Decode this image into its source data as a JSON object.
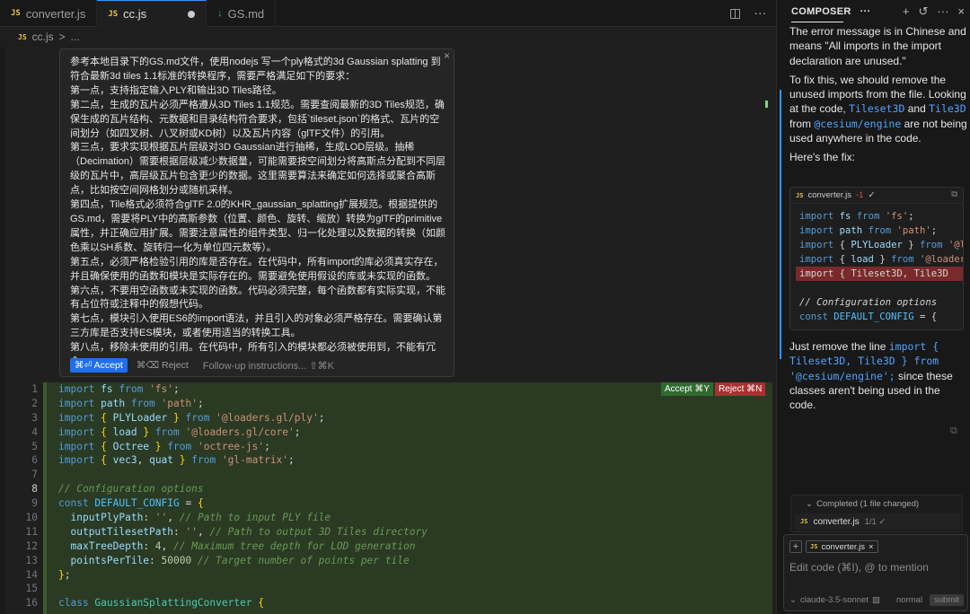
{
  "tabs": [
    {
      "icon": "JS",
      "label": "converter.js",
      "active": false
    },
    {
      "icon": "JS",
      "label": "cc.js",
      "active": true,
      "modified": true
    },
    {
      "icon": "↓",
      "label": "GS.md",
      "active": false
    }
  ],
  "breadcrumb": {
    "icon": "JS",
    "file": "cc.js",
    "sep": ">",
    "more": "..."
  },
  "prompt": {
    "lines": [
      "参考本地目录下的GS.md文件，使用nodejs 写一个ply格式的3d Gaussian splatting 到符合最新3d tiles 1.1标准的转换程序，需要严格满足如下的要求：",
      "第一点，支持指定输入PLY和输出3D Tiles路径。",
      "第二点，生成的瓦片必须严格遵从3D Tiles 1.1规范。需要查阅最新的3D Tiles规范，确保生成的瓦片结构、元数据和目录结构符合要求，包括`tileset.json`的格式、瓦片的空间划分（如四叉树、八叉树或KD树）以及瓦片内容（glTF文件）的引用。",
      "第三点，要求实现根据瓦片层级对3D Gaussian进行抽稀，生成LOD层级。抽稀（Decimation）需要根据层级减少数据量，可能需要按空间划分将高斯点分配到不同层级的瓦片中，高层级瓦片包含更少的数据。这里需要算法来确定如何选择或聚合高斯点，比如按空间网格划分或随机采样。",
      "第四点，Tile格式必须符合glTF 2.0的KHR_gaussian_splatting扩展规范。根据提供的GS.md，需要将PLY中的高斯参数（位置、颜色、旋转、缩放）转换为glTF的primitive属性，并正确应用扩展。需要注意属性的组件类型、归一化处理以及数据的转换（如颜色乘以SH系数、旋转归一化为单位四元数等）。",
      "第五点，必须严格检验引用的库是否存在。在代码中，所有import的库必须真实存在，并且确保使用的函数和模块是实际存在的。需要避免使用假设的库或未实现的函数。",
      "第六点，不要用空函数或未实现的函数。代码必须完整，每个函数都有实际实现，不能有占位符或注释中的假想代码。",
      "第七点，模块引入使用ES6的import语法，并且引入的对象必须严格存在。需要确认第三方库是否支持ES模块，或者使用适当的转换工具。",
      "第八点，移除未使用的引用。在代码中，所有引入的模块都必须被使用到，不能有冗余。"
    ],
    "close": "×",
    "accept_label": "⌘⏎ Accept",
    "reject_label": "⌘⌫ Reject",
    "followup_placeholder": "Follow-up instructions... ⇧⌘K"
  },
  "diff_buttons": {
    "accept": "Accept ⌘Y",
    "reject": "Reject ⌘N"
  },
  "code": {
    "current_line": 8,
    "lines": [
      {
        "n": "1",
        "parts": [
          [
            "kw",
            "import "
          ],
          [
            "var",
            "fs"
          ],
          [
            "kw",
            " from "
          ],
          [
            "str",
            "'fs'"
          ],
          [
            "",
            "; "
          ]
        ]
      },
      {
        "n": "2",
        "parts": [
          [
            "kw",
            "import "
          ],
          [
            "var",
            "path"
          ],
          [
            "kw",
            " from "
          ],
          [
            "str",
            "'path'"
          ],
          [
            "",
            ";"
          ]
        ]
      },
      {
        "n": "3",
        "parts": [
          [
            "kw",
            "import "
          ],
          [
            "brace",
            "{ "
          ],
          [
            "var",
            "PLYLoader"
          ],
          [
            "brace",
            " }"
          ],
          [
            "kw",
            " from "
          ],
          [
            "str",
            "'@loaders.gl/ply'"
          ],
          [
            "",
            ";"
          ]
        ]
      },
      {
        "n": "4",
        "parts": [
          [
            "kw",
            "import "
          ],
          [
            "brace",
            "{ "
          ],
          [
            "var",
            "load"
          ],
          [
            "brace",
            " }"
          ],
          [
            "kw",
            " from "
          ],
          [
            "str",
            "'@loaders.gl/core'"
          ],
          [
            "",
            ";"
          ]
        ]
      },
      {
        "n": "5",
        "parts": [
          [
            "kw",
            "import "
          ],
          [
            "brace",
            "{ "
          ],
          [
            "var",
            "Octree"
          ],
          [
            "brace",
            " }"
          ],
          [
            "kw",
            " from "
          ],
          [
            "str",
            "'octree-js'"
          ],
          [
            "",
            ";"
          ]
        ]
      },
      {
        "n": "6",
        "parts": [
          [
            "kw",
            "import "
          ],
          [
            "brace",
            "{ "
          ],
          [
            "var",
            "vec3"
          ],
          [
            "",
            ", "
          ],
          [
            "var",
            "quat"
          ],
          [
            "brace",
            " }"
          ],
          [
            "kw",
            " from "
          ],
          [
            "str",
            "'gl-matrix'"
          ],
          [
            "",
            ";"
          ]
        ]
      },
      {
        "n": "7",
        "parts": []
      },
      {
        "n": "8",
        "parts": [
          [
            "com",
            "// Configuration options"
          ]
        ]
      },
      {
        "n": "9",
        "parts": [
          [
            "kw",
            "const "
          ],
          [
            "const",
            "DEFAULT_CONFIG"
          ],
          [
            "",
            " = "
          ],
          [
            "brace",
            "{"
          ]
        ]
      },
      {
        "n": "10",
        "parts": [
          [
            "",
            "  "
          ],
          [
            "var",
            "inputPlyPath"
          ],
          [
            "",
            ": "
          ],
          [
            "str",
            "''"
          ],
          [
            "",
            ", "
          ],
          [
            "com",
            "// Path to input PLY file"
          ]
        ]
      },
      {
        "n": "11",
        "parts": [
          [
            "",
            "  "
          ],
          [
            "var",
            "outputTilesetPath"
          ],
          [
            "",
            ": "
          ],
          [
            "str",
            "''"
          ],
          [
            "",
            ", "
          ],
          [
            "com",
            "// Path to output 3D Tiles directory"
          ]
        ]
      },
      {
        "n": "12",
        "parts": [
          [
            "",
            "  "
          ],
          [
            "var",
            "maxTreeDepth"
          ],
          [
            "",
            ": "
          ],
          [
            "num",
            "4"
          ],
          [
            "",
            ", "
          ],
          [
            "com",
            "// Maximum tree depth for LOD generation"
          ]
        ]
      },
      {
        "n": "13",
        "parts": [
          [
            "",
            "  "
          ],
          [
            "var",
            "pointsPerTile"
          ],
          [
            "",
            ": "
          ],
          [
            "num",
            "50000"
          ],
          [
            "",
            " "
          ],
          [
            "com",
            "// Target number of points per tile"
          ]
        ]
      },
      {
        "n": "14",
        "parts": [
          [
            "brace",
            "}"
          ],
          [
            "",
            ";"
          ]
        ]
      },
      {
        "n": "15",
        "parts": []
      },
      {
        "n": "16",
        "parts": [
          [
            "kw",
            "class "
          ],
          [
            "cls",
            "GaussianSplattingConverter"
          ],
          [
            "",
            " "
          ],
          [
            "brace",
            "{"
          ]
        ]
      }
    ]
  },
  "composer": {
    "title": "COMPOSER",
    "intro": "The error message is in Chinese and means \"All imports in the import declaration are unused.\"",
    "fix_pre": "To fix this, we should remove the unused imports from the file. Looking at the code,",
    "fix_a": "Tileset3D",
    "fix_and": "and",
    "fix_b": "Tile3D",
    "fix_from": "from",
    "fix_pkg": "@cesium/engine",
    "fix_post": "are not being used anywhere in the code.",
    "heres": "Here's the fix:",
    "codeblock": {
      "icon": "JS",
      "file": "converter.js",
      "delta": "-1",
      "check": "✓",
      "lines": [
        "import fs from 'fs';",
        "import path from 'path';",
        "import { PLYLoader } from '@l",
        "import { load } from '@loader",
        "import { Tileset3D, Tile3D",
        "",
        "// Configuration options",
        "const DEFAULT_CONFIG = {"
      ]
    },
    "remove_pre": "Just remove the line",
    "remove_code": "import { Tileset3D, Tile3D } from '@cesium/engine';",
    "remove_post": "since these classes aren't being used in the code.",
    "completed_title": "Completed (1 file changed)",
    "completed_file": "converter.js",
    "completed_meta": "1/1 ✓",
    "chip_file": "converter.js",
    "input_placeholder": "Edit code (⌘I), @ to mention",
    "model": "claude-3.5-sonnet",
    "mode": "normal",
    "submit": "submit"
  }
}
